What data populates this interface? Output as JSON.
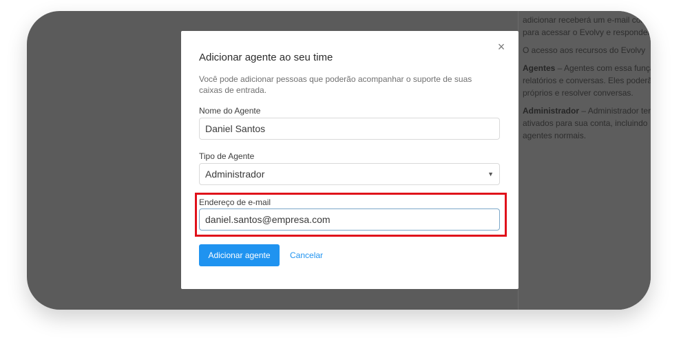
{
  "background_help": {
    "para1": "adicionar receberá um e-mail com para acessar o Evolvy e responder",
    "para2": "O acesso aos recursos do Evolvy",
    "para3_bold": "Agentes",
    "para3_rest": " – Agentes com essa função relatórios e conversas. Eles poderão próprios e resolver conversas.",
    "para4_bold": "Administrador",
    "para4_rest": " – Administrador terá ativados para sua conta, incluindo agentes normais."
  },
  "modal": {
    "title": "Adicionar agente ao seu time",
    "description": "Você pode adicionar pessoas que poderão acompanhar o suporte de suas caixas de entrada.",
    "close_icon": "×",
    "fields": {
      "name_label": "Nome do Agente",
      "name_value": "Daniel Santos",
      "type_label": "Tipo de Agente",
      "type_value": "Administrador",
      "email_label": "Endereço de e-mail",
      "email_value": "daniel.santos@empresa.com"
    },
    "buttons": {
      "submit": "Adicionar agente",
      "cancel": "Cancelar"
    }
  },
  "colors": {
    "primary": "#1f93f0",
    "highlight": "#e0101a",
    "overlay": "#5b5b5b"
  }
}
